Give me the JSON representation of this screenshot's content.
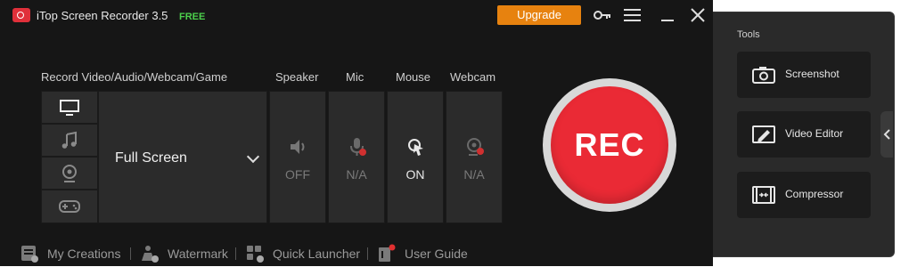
{
  "window": {
    "title": "iTop Screen Recorder 3.5",
    "badge": "FREE",
    "upgrade_label": "Upgrade"
  },
  "section_labels": {
    "record": "Record Video/Audio/Webcam/Game",
    "speaker": "Speaker",
    "mic": "Mic",
    "mouse": "Mouse",
    "webcam": "Webcam"
  },
  "capture": {
    "mode": "Full Screen",
    "sources": [
      "screen-icon",
      "music-icon",
      "webcam-icon",
      "gamepad-icon"
    ]
  },
  "devices": {
    "speaker_status": "OFF",
    "mic_status": "N/A",
    "mouse_status": "ON",
    "webcam_status": "N/A"
  },
  "rec_label": "REC",
  "bottom_bar": {
    "my_creations": "My Creations",
    "watermark": "Watermark",
    "quick_launcher": "Quick Launcher",
    "user_guide": "User Guide"
  },
  "tools": {
    "title": "Tools",
    "screenshot": "Screenshot",
    "video_editor": "Video Editor",
    "compressor": "Compressor"
  },
  "colors": {
    "accent": "#e7820f",
    "rec": "#ea2a35",
    "free": "#4cd04c",
    "background": "#161616"
  }
}
